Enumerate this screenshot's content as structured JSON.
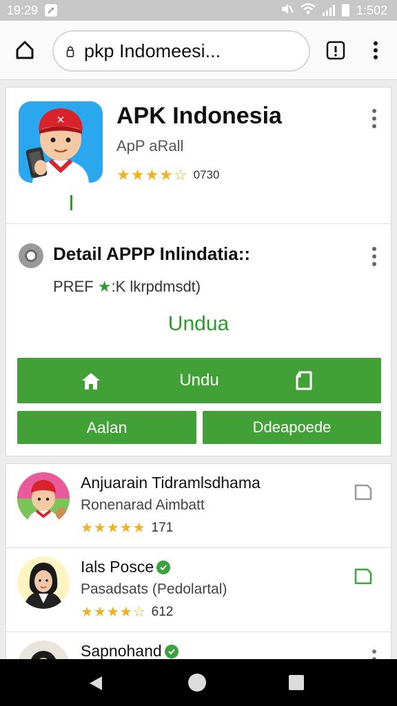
{
  "status_bar": {
    "time": "19:29",
    "battery_text": "1:502"
  },
  "browser": {
    "url": "pkp Indomeesi..."
  },
  "app": {
    "title": "APK Indonesia",
    "subtitle": "ApP aRall",
    "stars": "★★★★☆",
    "rating_count": "0730"
  },
  "detail": {
    "title": "Detail APPP Inlindatia::",
    "sub_prefix": "PREF ",
    "sub_star": "★",
    "sub_suffix": ":K lkrpdmsdt)",
    "green_link": "Undua",
    "download_button": "Undu",
    "left_button": "Aalan",
    "right_button": "Ddeapoede"
  },
  "list": [
    {
      "title": "Anjuarain Tidramlsdhama",
      "subtitle": "Ronenarad Aimbatt",
      "stars": "★★★★★",
      "rating": "171"
    },
    {
      "title": "Ials Posce",
      "subtitle": "Pasadsats (Pedolartal)",
      "stars": "★★★★☆",
      "rating": "612"
    },
    {
      "title": "Sapnohand",
      "subtitle": "",
      "stars": "",
      "rating": ""
    }
  ],
  "colors": {
    "accent_green": "#42a136",
    "star_yellow": "#f2b01e",
    "app_icon_blue": "#2ba7f0"
  }
}
